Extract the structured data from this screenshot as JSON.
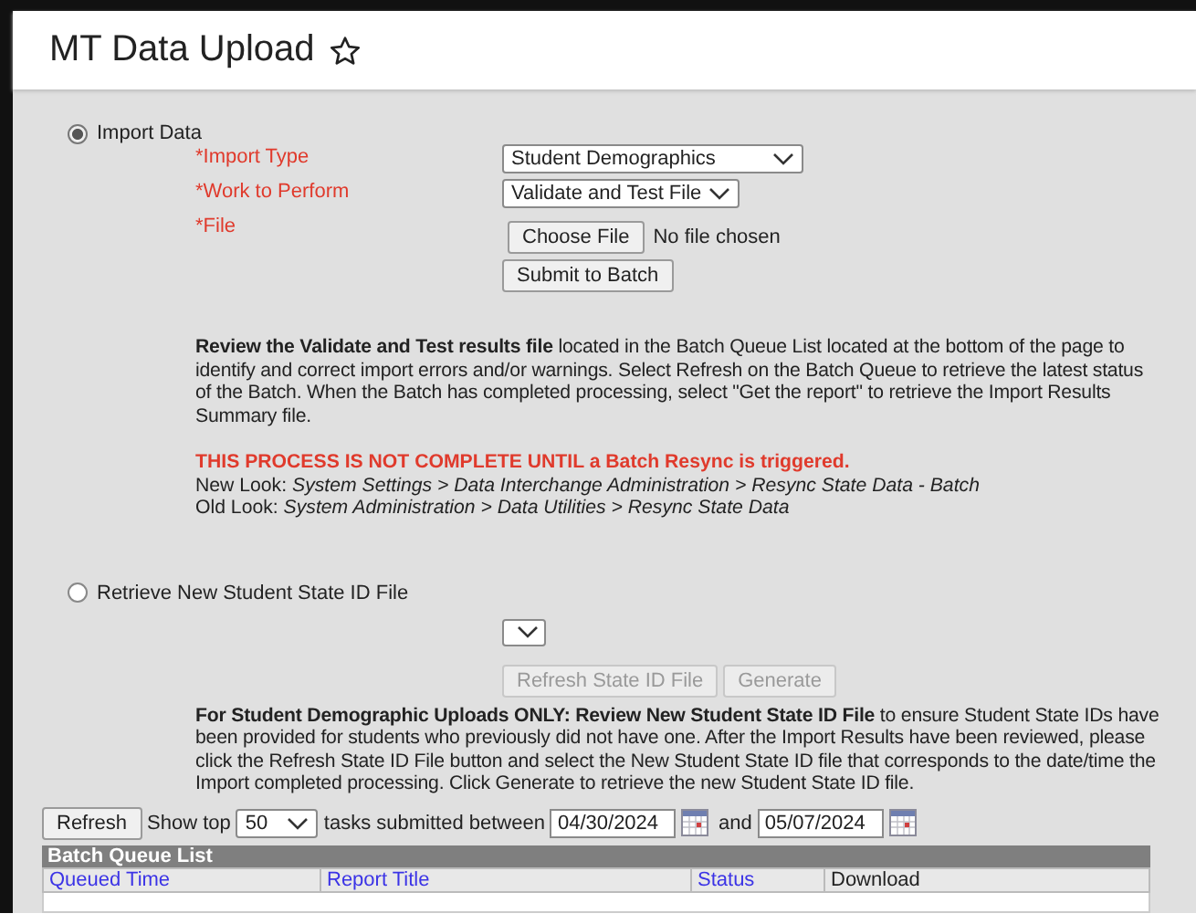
{
  "page": {
    "title": "MT Data Upload"
  },
  "import_section": {
    "option": {
      "label": "Import Data",
      "selected": true
    },
    "fields": [
      {
        "kind": "select",
        "label": "*Import Type",
        "value": "Student Demographics"
      },
      {
        "kind": "select",
        "label": "*Work to Perform",
        "value": "Validate and Test File"
      },
      {
        "kind": "file",
        "label": "*File",
        "button": "Choose File",
        "value": "No file chosen"
      }
    ],
    "submit_button": "Submit to Batch",
    "instructions": "**Review the Validate and Test results file** located in the Batch Queue List located at the bottom of the page to identify and correct import errors and/or warnings. Select Refresh on the Batch Queue to retrieve the latest status of the Batch. When the Batch has completed processing, select \"Get the report\" to retrieve the Import Results Summary file.",
    "warning": "THIS PROCESS IS NOT COMPLETE UNTIL a Batch Resync is triggered.",
    "paths": [
      "New Look: *System Settings > Data Interchange Administration > Resync State Data - Batch*",
      "Old Look: *System Administration > Data Utilities > Resync State Data*"
    ]
  },
  "state_id_section": {
    "option": {
      "label": "Retrieve New Student State ID File",
      "selected": false
    },
    "buttons": [
      {
        "label": "Refresh State ID File",
        "disabled": true
      },
      {
        "label": "Generate",
        "disabled": true
      }
    ],
    "instructions": "**For Student Demographic Uploads ONLY: Review New Student State ID File** to ensure Student State IDs have been provided for students who previously did not have one. After the Import Results have been reviewed, please click the Refresh State ID File button and select the New Student State ID file that corresponds to the date/time the Import completed processing. Click Generate to retrieve the new Student State ID file."
  },
  "batch_toolbar": {
    "refresh_button": "Refresh",
    "show_top_label": "Show top",
    "show_top_value": "50",
    "between_label": "tasks submitted between",
    "start_date": "04/30/2024",
    "and_label": "and",
    "end_date": "05/07/2024"
  },
  "batch_queue": {
    "title": "Batch Queue List",
    "columns": [
      {
        "label": "Queued Time",
        "kind": "link"
      },
      {
        "label": "Report Title",
        "kind": "link"
      },
      {
        "label": "Status",
        "kind": "link"
      },
      {
        "label": "Download",
        "kind": "text"
      }
    ]
  }
}
